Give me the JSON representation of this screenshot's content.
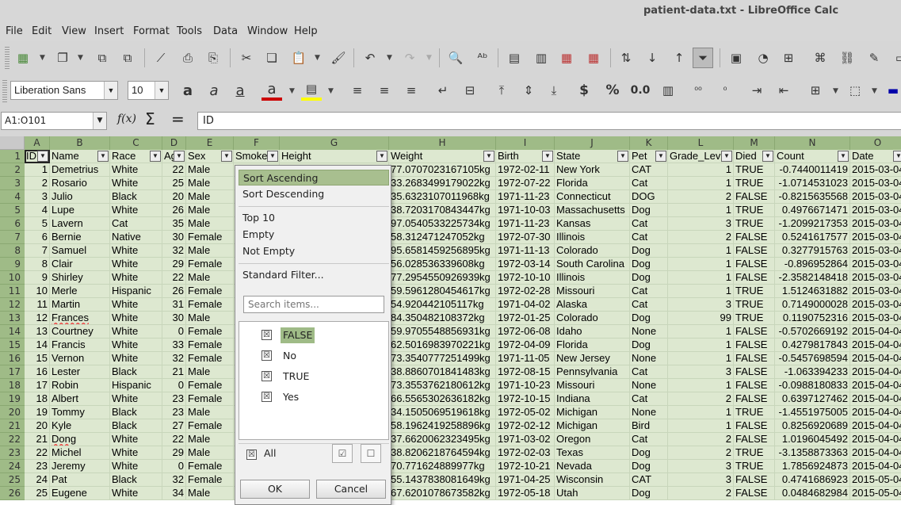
{
  "window": {
    "title": "patient-data.txt - LibreOffice Calc"
  },
  "menu": [
    "File",
    "Edit",
    "View",
    "Insert",
    "Format",
    "Tools",
    "Data",
    "Window",
    "Help"
  ],
  "format_toolbar": {
    "font_name": "Liberation Sans",
    "font_size": "10",
    "currency_symbol": "$",
    "percent_symbol": "%",
    "number_format": "0.0"
  },
  "formula_bar": {
    "name_box": "A1:O101",
    "fx_label": "f(x)",
    "sum_symbol": "Σ",
    "equals_symbol": "=",
    "content": "ID"
  },
  "sheet": {
    "column_letters": [
      "A",
      "B",
      "C",
      "D",
      "E",
      "F",
      "G",
      "H",
      "I",
      "J",
      "K",
      "L",
      "M",
      "N",
      "O"
    ],
    "headers": [
      "ID",
      "Name",
      "Race",
      "Age",
      "Sex",
      "Smoker",
      "Height",
      "Weight",
      "Birth",
      "State",
      "Pet",
      "Grade_Level",
      "Died",
      "Count",
      "Date"
    ],
    "header_display": [
      "ID",
      "Name",
      "Race",
      "Ag",
      "Sex",
      "Smoke",
      "Height",
      "Weight",
      "Birth",
      "State",
      "Pet",
      "Grade_Lev",
      "Died",
      "Count",
      "Date"
    ],
    "row_numbers": [
      "1",
      "2",
      "3",
      "4",
      "5",
      "6",
      "7",
      "8",
      "9",
      "10",
      "11",
      "12",
      "13",
      "14",
      "15",
      "16",
      "17",
      "18",
      "19",
      "20",
      "21",
      "22",
      "23",
      "24",
      "25",
      "26"
    ],
    "rows": [
      [
        "1",
        "Demetrius",
        "White",
        "22",
        "Male",
        "",
        "",
        "77.0707023167105kg",
        "1972-02-11",
        "New York",
        "CAT",
        "1",
        "TRUE",
        "-0.7440011419",
        "2015-03-04"
      ],
      [
        "2",
        "Rosario",
        "White",
        "25",
        "Male",
        "",
        "",
        "33.2683499179022kg",
        "1972-07-22",
        "Florida",
        "Cat",
        "1",
        "TRUE",
        "-1.0714531023",
        "2015-03-04"
      ],
      [
        "3",
        "Julio",
        "Black",
        "20",
        "Male",
        "",
        "",
        "35.6323107011968kg",
        "1971-11-23",
        "Connecticut",
        "DOG",
        "2",
        "FALSE",
        "-0.8215635568",
        "2015-03-04"
      ],
      [
        "4",
        "Lupe",
        "White",
        "26",
        "Male",
        "",
        "",
        "38.7203170843447kg",
        "1971-10-03",
        "Massachusetts",
        "Dog",
        "1",
        "TRUE",
        "0.4976671471",
        "2015-03-04"
      ],
      [
        "5",
        "Lavern",
        "Cat",
        "35",
        "Male",
        "",
        "",
        "97.0540533225734kg",
        "1971-11-23",
        "Kansas",
        "Cat",
        "3",
        "TRUE",
        "-1.2099217353",
        "2015-03-04"
      ],
      [
        "6",
        "Bernie",
        "Native",
        "30",
        "Female",
        "",
        "",
        "58.312471247052kg",
        "1972-07-30",
        "Illinois",
        "Cat",
        "2",
        "FALSE",
        "0.5241617577",
        "2015-03-04"
      ],
      [
        "7",
        "Samuel",
        "White",
        "32",
        "Male",
        "",
        "",
        "95.6581459256895kg",
        "1971-11-13",
        "Colorado",
        "Dog",
        "1",
        "FALSE",
        "0.3277915763",
        "2015-03-04"
      ],
      [
        "8",
        "Clair",
        "White",
        "29",
        "Female",
        "",
        "",
        "56.028536339608kg",
        "1972-03-14",
        "South Carolina",
        "Dog",
        "1",
        "FALSE",
        "-0.896952864",
        "2015-03-04"
      ],
      [
        "9",
        "Shirley",
        "White",
        "22",
        "Male",
        "",
        "",
        "77.2954550926939kg",
        "1972-10-10",
        "Illinois",
        "Dog",
        "1",
        "FALSE",
        "-2.3582148418",
        "2015-03-04"
      ],
      [
        "10",
        "Merle",
        "Hispanic",
        "26",
        "Female",
        "",
        "",
        "59.5961280454617kg",
        "1972-02-28",
        "Missouri",
        "Cat",
        "1",
        "TRUE",
        "1.5124631882",
        "2015-03-04"
      ],
      [
        "11",
        "Martin",
        "White",
        "31",
        "Female",
        "",
        "",
        "54.920442105117kg",
        "1971-04-02",
        "Alaska",
        "Cat",
        "3",
        "TRUE",
        "0.7149000028",
        "2015-03-04"
      ],
      [
        "12",
        "Frances",
        "White",
        "30",
        "Male",
        "",
        "",
        "84.350482108372kg",
        "1972-01-25",
        "Colorado",
        "Dog",
        "99",
        "TRUE",
        "0.1190752316",
        "2015-03-04"
      ],
      [
        "13",
        "Courtney",
        "White",
        "0",
        "Female",
        "",
        "",
        "59.9705548856931kg",
        "1972-06-08",
        "Idaho",
        "None",
        "1",
        "FALSE",
        "-0.5702669192",
        "2015-04-04"
      ],
      [
        "14",
        "Francis",
        "White",
        "33",
        "Female",
        "",
        "",
        "62.5016983970221kg",
        "1972-04-09",
        "Florida",
        "Dog",
        "1",
        "FALSE",
        "0.4279817843",
        "2015-04-04"
      ],
      [
        "15",
        "Vernon",
        "White",
        "32",
        "Female",
        "",
        "",
        "73.3540777251499kg",
        "1971-11-05",
        "New Jersey",
        "None",
        "1",
        "FALSE",
        "-0.5457698594",
        "2015-04-04"
      ],
      [
        "16",
        "Lester",
        "Black",
        "21",
        "Male",
        "",
        "",
        "38.8860701841483kg",
        "1972-08-15",
        "Pennsylvania",
        "Cat",
        "3",
        "FALSE",
        "-1.063394233",
        "2015-04-04"
      ],
      [
        "17",
        "Robin",
        "Hispanic",
        "0",
        "Female",
        "",
        "",
        "73.3553762180612kg",
        "1971-10-23",
        "Missouri",
        "None",
        "1",
        "FALSE",
        "-0.0988180833",
        "2015-04-04"
      ],
      [
        "18",
        "Albert",
        "White",
        "23",
        "Female",
        "",
        "",
        "66.5565302636182kg",
        "1972-10-15",
        "Indiana",
        "Cat",
        "2",
        "FALSE",
        "0.6397127462",
        "2015-04-04"
      ],
      [
        "19",
        "Tommy",
        "Black",
        "23",
        "Male",
        "",
        "",
        "34.1505069519618kg",
        "1972-05-02",
        "Michigan",
        "None",
        "1",
        "TRUE",
        "-1.4551975005",
        "2015-04-04"
      ],
      [
        "20",
        "Kyle",
        "Black",
        "27",
        "Female",
        "",
        "",
        "58.1962419258896kg",
        "1972-02-12",
        "Michigan",
        "Bird",
        "1",
        "FALSE",
        "0.8256920689",
        "2015-04-04"
      ],
      [
        "21",
        "Dong",
        "White",
        "22",
        "Male",
        "",
        "",
        "37.6620062323495kg",
        "1971-03-02",
        "Oregon",
        "Cat",
        "2",
        "FALSE",
        "1.0196045492",
        "2015-04-04"
      ],
      [
        "22",
        "Michel",
        "White",
        "29",
        "Male",
        "",
        "",
        "38.8206218764594kg",
        "1972-02-03",
        "Texas",
        "Dog",
        "2",
        "TRUE",
        "-3.1358873363",
        "2015-04-04"
      ],
      [
        "23",
        "Jeremy",
        "White",
        "0",
        "Female",
        "",
        "",
        "70.771624889977kg",
        "1972-10-21",
        "Nevada",
        "Dog",
        "3",
        "TRUE",
        "1.7856924873",
        "2015-04-04"
      ],
      [
        "24",
        "Pat",
        "Black",
        "32",
        "Female",
        "",
        "",
        "55.1437838081649kg",
        "1971-04-25",
        "Wisconsin",
        "CAT",
        "3",
        "FALSE",
        "0.4741686923",
        "2015-05-04"
      ],
      [
        "25",
        "Eugene",
        "White",
        "34",
        "Male",
        "",
        "",
        "67.6201078673582kg",
        "1972-05-18",
        "Utah",
        "Dog",
        "2",
        "FALSE",
        "0.0484682984",
        "2015-05-04"
      ]
    ]
  },
  "autofilter_popup": {
    "sort_ascending": "Sort Ascending",
    "sort_descending": "Sort Descending",
    "top10": "Top 10",
    "empty": "Empty",
    "not_empty": "Not Empty",
    "standard_filter": "Standard Filter...",
    "search_placeholder": "Search items...",
    "values": [
      {
        "label": "FALSE",
        "checked": true
      },
      {
        "label": "No",
        "checked": true
      },
      {
        "label": "TRUE",
        "checked": true
      },
      {
        "label": "Yes",
        "checked": true
      }
    ],
    "all_label": "All",
    "ok_label": "OK",
    "cancel_label": "Cancel"
  }
}
